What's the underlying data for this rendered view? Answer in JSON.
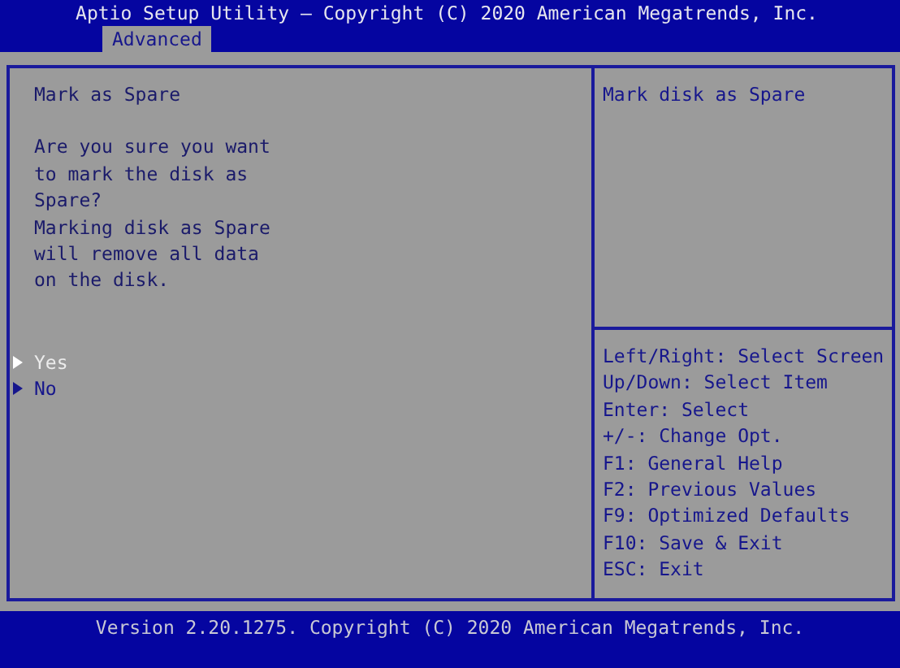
{
  "header": {
    "title": "Aptio Setup Utility – Copyright (C) 2020 American Megatrends, Inc.",
    "tabs": [
      {
        "label": "Advanced",
        "selected": true
      }
    ]
  },
  "dialog": {
    "title": "Mark as Spare",
    "message_lines": [
      "Are you sure you want",
      "to mark the disk as",
      "Spare?",
      "Marking disk as Spare",
      "will remove all data",
      "on the disk."
    ],
    "options": [
      {
        "label": "Yes",
        "selected": true
      },
      {
        "label": "No",
        "selected": false
      }
    ]
  },
  "help": {
    "description": "Mark disk as Spare",
    "keys": [
      "Left/Right: Select Screen",
      "Up/Down: Select Item",
      "Enter: Select",
      "+/-: Change Opt.",
      "F1: General Help",
      "F2: Previous Values",
      "F9: Optimized Defaults",
      "F10: Save & Exit",
      "ESC: Exit"
    ]
  },
  "footer": {
    "version": "Version 2.20.1275. Copyright (C) 2020 American Megatrends, Inc."
  }
}
